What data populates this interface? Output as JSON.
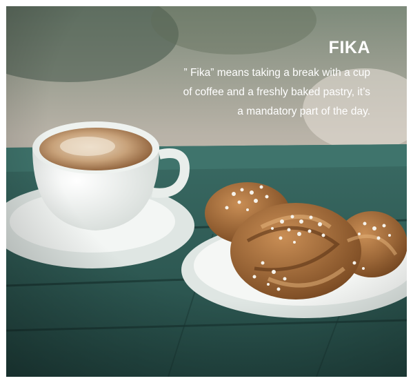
{
  "overlay": {
    "title": "FIKA",
    "caption_lines": [
      "” Fika” means taking a break with a cup",
      "of coffee and a freshly baked pastry, it’s",
      "a mandatory part of the day."
    ]
  },
  "scene": {
    "subject": "coffee cup with saucer and cardamom buns on a plate",
    "colors": {
      "table": "#2f5d58",
      "table_dark": "#1f403c",
      "background_light": "#d8d0c6",
      "coffee": "#c09a72",
      "pastry": "#a86e3c",
      "sugar": "#f4f1ea"
    }
  }
}
